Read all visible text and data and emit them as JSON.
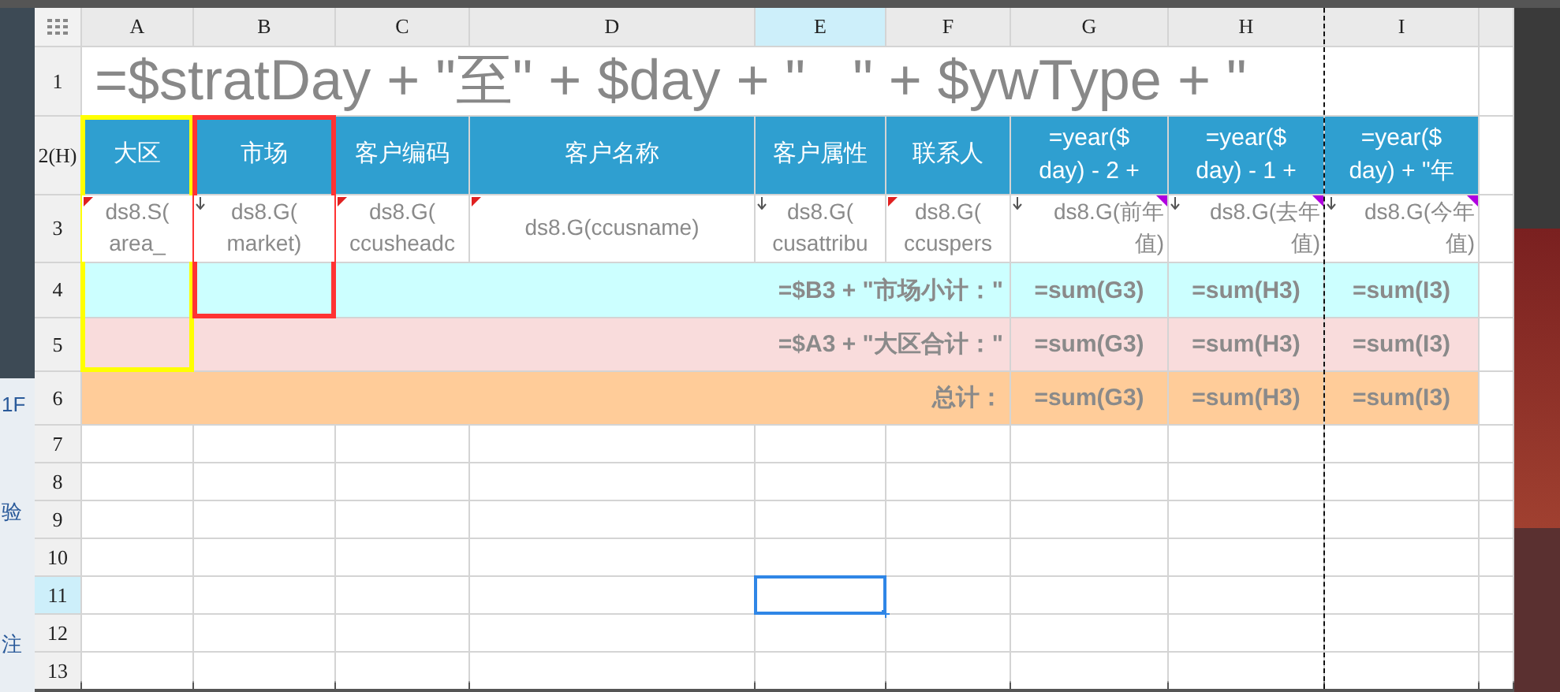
{
  "side_fragments": [
    {
      "text": "1F"
    },
    {
      "text": "验"
    },
    {
      "text": "注"
    }
  ],
  "column_headers": [
    {
      "label": "A",
      "selected": false
    },
    {
      "label": "B",
      "selected": false
    },
    {
      "label": "C",
      "selected": false
    },
    {
      "label": "D",
      "selected": false
    },
    {
      "label": "E",
      "selected": true
    },
    {
      "label": "F",
      "selected": false
    },
    {
      "label": "G",
      "selected": false
    },
    {
      "label": "H",
      "selected": false
    },
    {
      "label": "I",
      "selected": false
    }
  ],
  "title_row": {
    "number": "1",
    "formula": "=$stratDay + \"至\" + $day + \"   \" + $ywType + \""
  },
  "header_row": {
    "number": "2(H)",
    "cells": [
      {
        "lines": [
          "大区"
        ]
      },
      {
        "lines": [
          "市场"
        ]
      },
      {
        "lines": [
          "客户编码"
        ]
      },
      {
        "lines": [
          "客户名称"
        ]
      },
      {
        "lines": [
          "客户属性"
        ]
      },
      {
        "lines": [
          "联系人"
        ]
      },
      {
        "lines": [
          "=year($",
          "day) - 2 +"
        ]
      },
      {
        "lines": [
          "=year($",
          "day) - 1 +"
        ]
      },
      {
        "lines": [
          "=year($",
          "day) + \"年"
        ]
      }
    ]
  },
  "data_row": {
    "number": "3",
    "cells": [
      {
        "lines": [
          "ds8.S(",
          "area_"
        ],
        "flag": true,
        "arrow": false,
        "condition": false
      },
      {
        "lines": [
          "ds8.G(",
          "market)"
        ],
        "flag": false,
        "arrow": true,
        "condition": false
      },
      {
        "lines": [
          "ds8.G(",
          "ccusheadc"
        ],
        "flag": true,
        "arrow": false,
        "condition": false
      },
      {
        "lines": [
          "ds8.G(ccusname)"
        ],
        "flag": true,
        "arrow": false,
        "condition": false
      },
      {
        "lines": [
          "ds8.G(",
          "cusattribu"
        ],
        "flag": false,
        "arrow": true,
        "condition": false
      },
      {
        "lines": [
          "ds8.G(",
          "ccuspers"
        ],
        "flag": true,
        "arrow": false,
        "condition": false
      },
      {
        "lines": [
          "ds8.G(前年",
          "值)"
        ],
        "flag": false,
        "arrow": true,
        "condition": true
      },
      {
        "lines": [
          "ds8.G(去年",
          "值)"
        ],
        "flag": false,
        "arrow": true,
        "condition": true
      },
      {
        "lines": [
          "ds8.G(今年",
          "值)"
        ],
        "flag": false,
        "arrow": true,
        "condition": true
      }
    ]
  },
  "summary_rows": [
    {
      "number": "4",
      "kind": "market",
      "label": "=$B3 + \"市场小计：\"",
      "sums": [
        "=sum(G3)",
        "=sum(H3)",
        "=sum(I3)"
      ]
    },
    {
      "number": "5",
      "kind": "area",
      "label": "=$A3 + \"大区合计：\"",
      "sums": [
        "=sum(G3)",
        "=sum(H3)",
        "=sum(I3)"
      ]
    },
    {
      "number": "6",
      "kind": "total",
      "label": "总计：",
      "sums": [
        "=sum(G3)",
        "=sum(H3)",
        "=sum(I3)"
      ]
    }
  ],
  "empty_rows": [
    {
      "number": "7",
      "selected": false
    },
    {
      "number": "8",
      "selected": false
    },
    {
      "number": "9",
      "selected": false
    },
    {
      "number": "10",
      "selected": false
    },
    {
      "number": "11",
      "selected": true
    },
    {
      "number": "12",
      "selected": false
    },
    {
      "number": "13",
      "selected": false
    }
  ],
  "outlines": [
    {
      "color": "#ffff00"
    },
    {
      "color": "#ff3333"
    }
  ]
}
